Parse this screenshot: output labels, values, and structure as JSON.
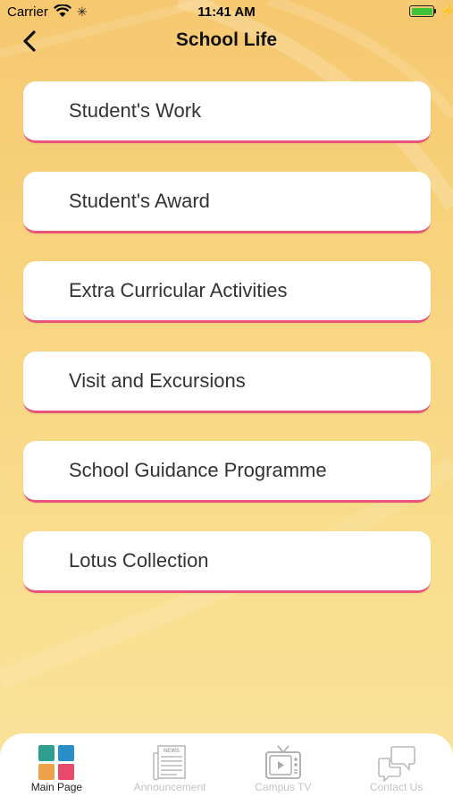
{
  "status_bar": {
    "carrier": "Carrier",
    "time": "11:41 AM",
    "battery_level": 1.0
  },
  "nav": {
    "title": "School Life"
  },
  "menu": {
    "items": [
      {
        "label": "Student's Work"
      },
      {
        "label": "Student's Award"
      },
      {
        "label": "Extra Curricular Activities"
      },
      {
        "label": "Visit and Excursions"
      },
      {
        "label": "School Guidance Programme"
      },
      {
        "label": "Lotus Collection"
      }
    ]
  },
  "tab_bar": {
    "tabs": [
      {
        "label": "Main Page",
        "icon": "grid-icon",
        "active": true
      },
      {
        "label": "Announcement",
        "icon": "newspaper-icon",
        "active": false
      },
      {
        "label": "Campus TV",
        "icon": "tv-icon",
        "active": false
      },
      {
        "label": "Contact Us",
        "icon": "chat-bubbles-icon",
        "active": false
      }
    ]
  },
  "colors": {
    "background_top": "#f6c870",
    "background_bottom": "#f9e39c",
    "item_underline": "#e8547a",
    "grid_teal": "#2e9e8f",
    "grid_blue": "#2a8fc9",
    "grid_orange": "#eda24a",
    "grid_pink": "#e84a6b"
  }
}
